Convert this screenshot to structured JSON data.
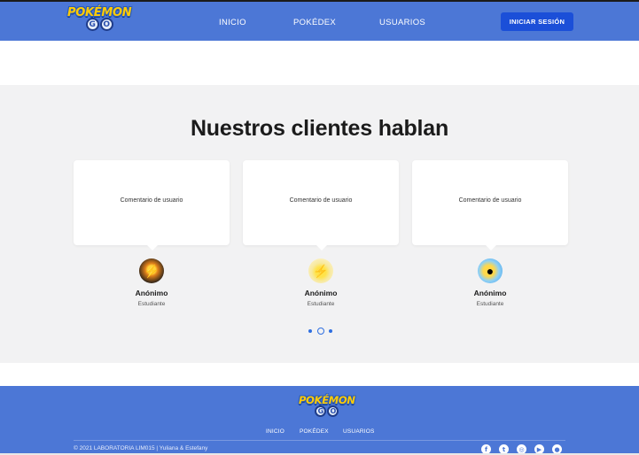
{
  "colors": {
    "nav_bg": "#4c77d6",
    "button_bg": "#1b4fd8",
    "section_bg": "#f2f2f3",
    "dot": "#2f6fe0"
  },
  "brand": {
    "logo_word": "POKÉMON",
    "logo_go": [
      "G",
      "O"
    ]
  },
  "nav": {
    "links": [
      "INICIO",
      "POKÉDEX",
      "USUARIOS"
    ],
    "login_label": "INICIAR SESIÓN"
  },
  "testimonials": {
    "title": "Nuestros clientes hablan",
    "items": [
      {
        "comment": "Comentario de usuario",
        "name": "Anónimo",
        "role": "Estudiante",
        "avatar_icon": "pokemon-avatar-icon"
      },
      {
        "comment": "Comentario de usuario",
        "name": "Anónimo",
        "role": "Estudiante",
        "avatar_icon": "pikachu-avatar-icon"
      },
      {
        "comment": "Comentario de usuario",
        "name": "Anónimo",
        "role": "Estudiante",
        "avatar_icon": "psyduck-avatar-icon"
      }
    ],
    "carousel": {
      "dots": 3,
      "active_index": 1
    }
  },
  "footer": {
    "links": [
      "INICIO",
      "POKÉDEX",
      "USUARIOS"
    ],
    "copyright": "© 2021 LABORATORIA LIM015 | Yuliana & Estefany",
    "social": [
      "facebook-icon",
      "twitter-icon",
      "instagram-icon",
      "youtube-icon",
      "github-icon"
    ]
  }
}
